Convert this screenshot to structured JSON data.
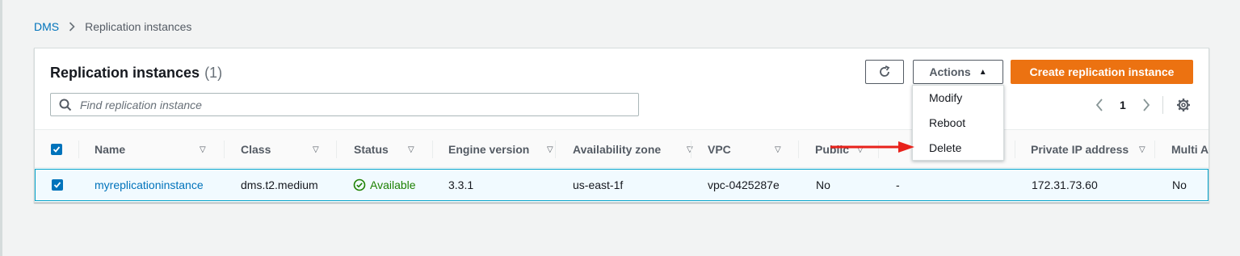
{
  "breadcrumb": {
    "root": "DMS",
    "current": "Replication instances"
  },
  "panel": {
    "title": "Replication instances",
    "count": "(1)"
  },
  "search": {
    "placeholder": "Find replication instance",
    "value": ""
  },
  "toolbar": {
    "refresh_icon": "refresh-icon",
    "actions_label": "Actions",
    "create_label": "Create replication instance"
  },
  "actions_menu": {
    "items": [
      "Modify",
      "Reboot",
      "Delete"
    ]
  },
  "pagination": {
    "current_page": "1"
  },
  "table": {
    "headers": {
      "name": "Name",
      "class": "Class",
      "status": "Status",
      "engine_version": "Engine version",
      "availability_zone": "Availability zone",
      "vpc": "VPC",
      "public": "Public",
      "private_ip": "Private IP address",
      "multi_az": "Multi AZ"
    },
    "rows": [
      {
        "selected": true,
        "name": "myreplicationinstance",
        "class": "dms.t2.medium",
        "status": "Available",
        "engine_version": "3.3.1",
        "availability_zone": "us-east-1f",
        "vpc": "vpc-0425287e",
        "public": "No",
        "public_ip": "-",
        "private_ip": "172.31.73.60",
        "multi_az": "No"
      }
    ]
  },
  "colors": {
    "accent": "#0073bb",
    "primary_button": "#ec7211",
    "status_ok": "#1d8102",
    "annotation_arrow": "#e8221b"
  }
}
